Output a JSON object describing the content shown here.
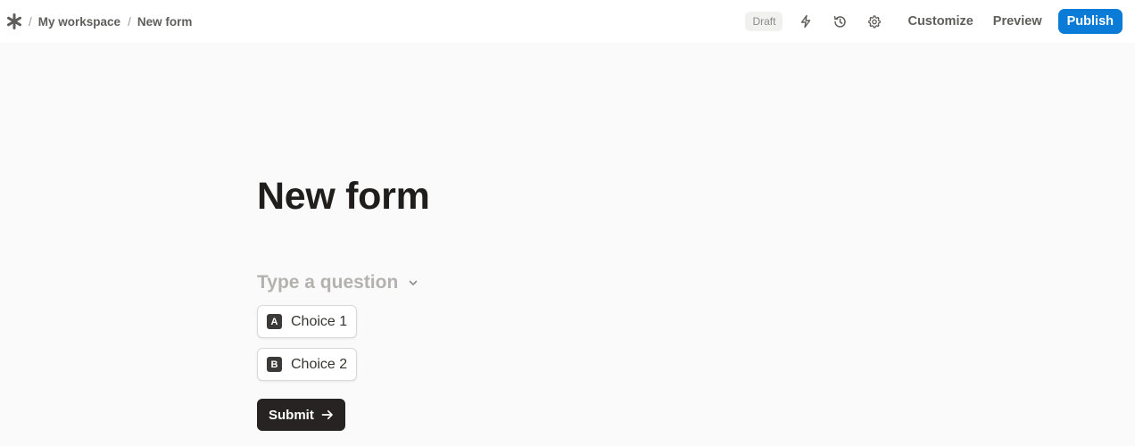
{
  "breadcrumb": {
    "logo_icon": "asterisk-logo-icon",
    "separator": "/",
    "items": [
      {
        "label": "My workspace"
      },
      {
        "label": "New form"
      }
    ]
  },
  "toolbar": {
    "status_badge": "Draft",
    "icons": [
      "lightning-icon",
      "history-icon",
      "gear-icon"
    ],
    "customize_label": "Customize",
    "preview_label": "Preview",
    "publish_label": "Publish",
    "publish_color": "#0b7bd8"
  },
  "form": {
    "title": "New form",
    "question_placeholder": "Type a question",
    "choices": [
      {
        "key": "A",
        "label": "Choice 1"
      },
      {
        "key": "B",
        "label": "Choice 2"
      }
    ],
    "submit_label": "Submit"
  }
}
